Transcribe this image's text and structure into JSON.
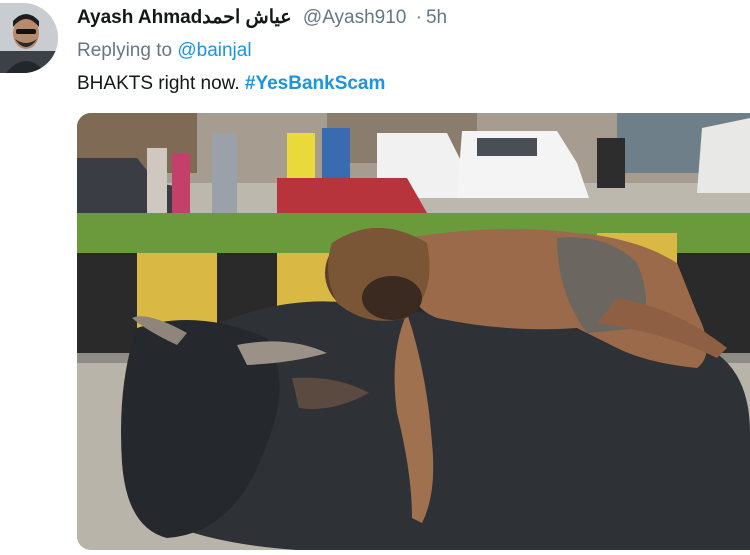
{
  "tweet": {
    "display_name": "Ayash Ahmad",
    "display_name_arabic": "عياش احمد",
    "handle": "@Ayash910",
    "separator": "·",
    "time": "5h",
    "replying_prefix": "Replying to",
    "replying_to": "@bainjal",
    "text": "BHAKTS right now.",
    "hashtag": "#YesBankScam"
  },
  "media": {
    "description_icon": "photo-icon"
  },
  "colors": {
    "link": "#1b95e0",
    "secondary_text": "#657786",
    "primary_text": "#14171a"
  }
}
